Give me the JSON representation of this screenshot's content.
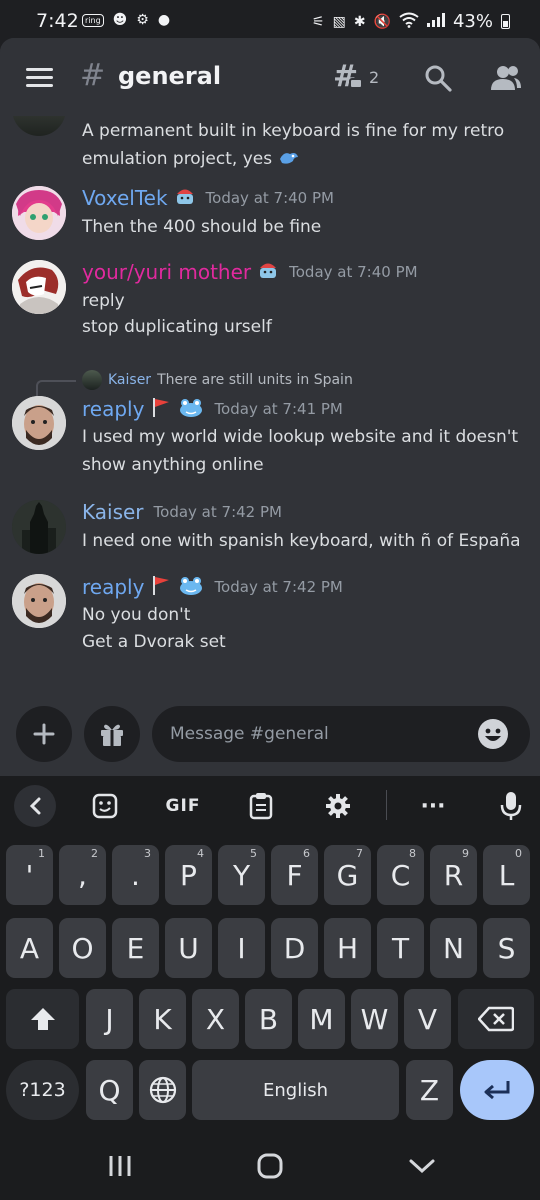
{
  "status_bar": {
    "time": "7:42",
    "left_icons": [
      "ring-notification-icon",
      "person-notification-icon",
      "robot-notification-icon",
      "dot-icon"
    ],
    "app_label": "ring",
    "right_icons": [
      "key-icon",
      "lock-icon",
      "bluetooth-icon",
      "mute-icon",
      "wifi-icon",
      "signal-icon",
      "battery-icon"
    ],
    "battery": "43%"
  },
  "header": {
    "channel_prefix": "#",
    "channel_name": "general",
    "threads_count": "2"
  },
  "messages": [
    {
      "id": "partial",
      "lines": [
        "A permanent built in keyboard is fine for my retro",
        "emulation project, yes"
      ],
      "trailing_emoji": "dragon-emoji"
    },
    {
      "id": "voxeltek",
      "author": "VoxelTek",
      "author_color": "#6fa8f0",
      "badge": "ramen-badge",
      "timestamp": "Today at 7:40 PM",
      "lines": [
        "Then the 400 should be fine"
      ]
    },
    {
      "id": "yuri",
      "author": "your/yuri mother",
      "author_color": "#e02a9e",
      "badge": "ramen-badge",
      "timestamp": "Today at 7:40 PM",
      "lines": [
        "reply",
        "stop duplicating urself"
      ]
    },
    {
      "id": "reaply1",
      "reply_to": {
        "author": "Kaiser",
        "text": "There are still units in Spain"
      },
      "author": "reaply",
      "author_color": "#6fa8f0",
      "badges": [
        "red-flag-badge",
        "frog-badge"
      ],
      "timestamp": "Today at 7:41 PM",
      "lines": [
        "I used my world wide lookup website and it doesn't",
        "show anything online"
      ]
    },
    {
      "id": "kaiser",
      "author": "Kaiser",
      "author_color": "#8ab4e8",
      "timestamp": "Today at 7:42 PM",
      "lines": [
        "I need one with spanish keyboard, with ñ of España"
      ]
    },
    {
      "id": "reaply2",
      "author": "reaply",
      "author_color": "#6fa8f0",
      "badges": [
        "red-flag-badge",
        "frog-badge"
      ],
      "timestamp": "Today at 7:42 PM",
      "lines": [
        "No you don't",
        "Get a Dvorak set"
      ]
    }
  ],
  "composer": {
    "placeholder": "Message #general"
  },
  "keyboard": {
    "toolbar": {
      "gif_label": "GIF",
      "items": [
        "back-chevron-icon",
        "sticker-icon",
        "gif-icon",
        "clipboard-icon",
        "settings-icon",
        "more-icon",
        "microphone-icon"
      ]
    },
    "row1": [
      {
        "label": "'",
        "hint": "1"
      },
      {
        "label": ",",
        "hint": "2"
      },
      {
        "label": ".",
        "hint": "3"
      },
      {
        "label": "P",
        "hint": "4"
      },
      {
        "label": "Y",
        "hint": "5"
      },
      {
        "label": "F",
        "hint": "6"
      },
      {
        "label": "G",
        "hint": "7"
      },
      {
        "label": "C",
        "hint": "8"
      },
      {
        "label": "R",
        "hint": "9"
      },
      {
        "label": "L",
        "hint": "0"
      }
    ],
    "row2": [
      "A",
      "O",
      "E",
      "U",
      "I",
      "D",
      "H",
      "T",
      "N",
      "S"
    ],
    "row3": [
      "J",
      "K",
      "X",
      "B",
      "M",
      "W",
      "V"
    ],
    "row4": {
      "symbols": "?123",
      "q": "Q",
      "space": "English",
      "z": "Z"
    }
  },
  "colors": {
    "background": "#313338",
    "header_bg": "#313338",
    "input_bg": "#1e1f22",
    "keyboard_bg": "#1b1c1e",
    "key_bg": "#3b3d42",
    "enter_key": "#a8c7fa"
  }
}
